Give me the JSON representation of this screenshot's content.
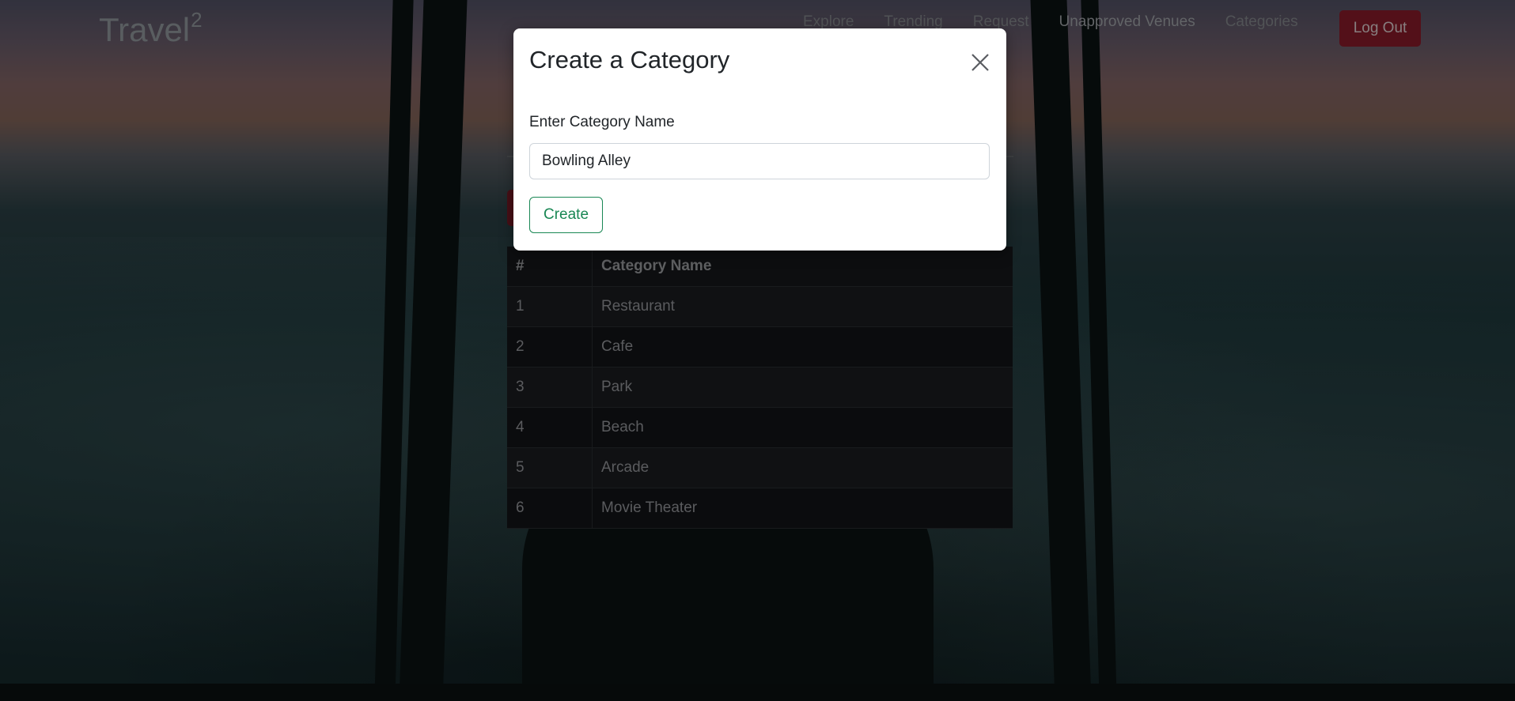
{
  "navbar": {
    "brand": "Travel",
    "brand_sup": "2",
    "links": [
      "Explore",
      "Trending",
      "Request",
      "Unapproved Venues",
      "Categories"
    ],
    "logout_label": "Log Out"
  },
  "table": {
    "headers": [
      "#",
      "Category Name"
    ],
    "rows": [
      [
        "1",
        "Restaurant"
      ],
      [
        "2",
        "Cafe"
      ],
      [
        "3",
        "Park"
      ],
      [
        "4",
        "Beach"
      ],
      [
        "5",
        "Arcade"
      ],
      [
        "6",
        "Movie Theater"
      ]
    ]
  },
  "modal": {
    "title": "Create a Category",
    "field_label": "Enter Category Name",
    "field_value": "Bowling Alley",
    "create_label": "Create"
  },
  "colors": {
    "logout_bg": "#8f1d2c",
    "create_border": "#198754"
  }
}
